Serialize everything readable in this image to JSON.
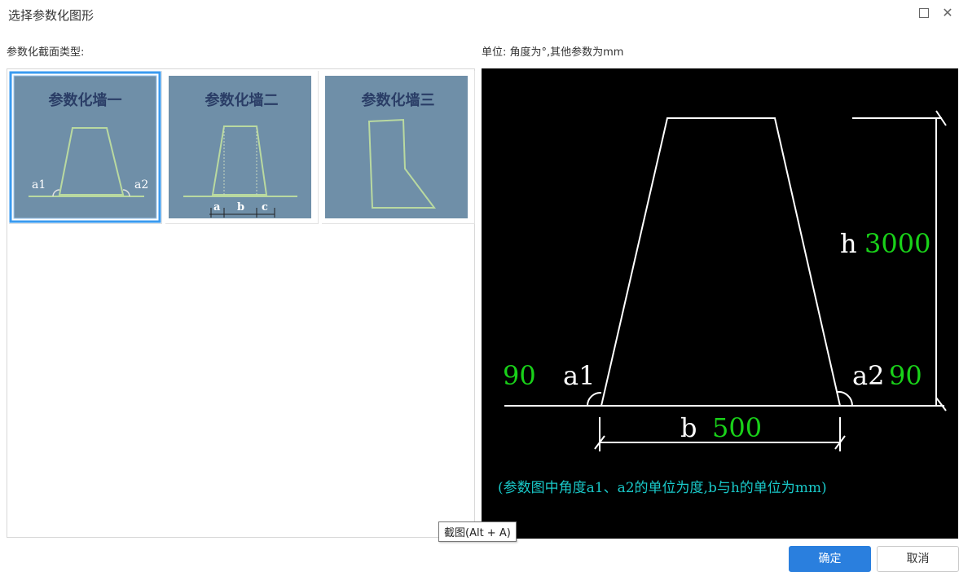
{
  "dialog": {
    "title": "选择参数化图形"
  },
  "left_panel": {
    "label": "参数化截面类型:"
  },
  "right_panel": {
    "label": "单位:  角度为°,其他参数为mm"
  },
  "thumbnails": [
    {
      "title": "参数化墙一",
      "labels": [
        "a1",
        "a2"
      ]
    },
    {
      "title": "参数化墙二",
      "labels": [
        "a",
        "b",
        "c"
      ]
    },
    {
      "title": "参数化墙三",
      "labels": []
    }
  ],
  "preview": {
    "h_label": "h",
    "h_value": "3000",
    "a1_label": "a1",
    "a1_value": "90",
    "a2_label": "a2",
    "a2_value": "90",
    "b_label": "b",
    "b_value": "500",
    "note": "(参数图中角度a1、a2的单位为度,b与h的单位为mm)"
  },
  "tooltip": "截图(Alt + A)",
  "buttons": {
    "ok": "确定",
    "cancel": "取消"
  },
  "colors": {
    "accent": "#2a7fde",
    "thumb_bg": "#6f8fa8",
    "value_green": "#19d119",
    "note_cyan": "#19c8c8"
  }
}
